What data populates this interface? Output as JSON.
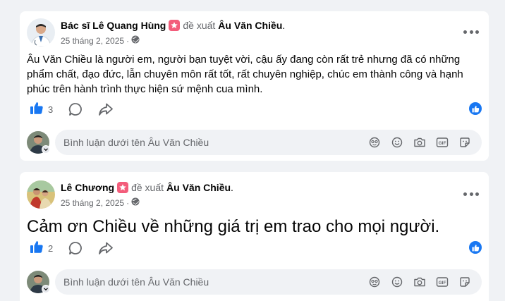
{
  "posts": [
    {
      "author": "Bác sĩ Lê Quang Hùng",
      "recommend_text": "đề xuất",
      "target": "Âu Văn Chiều",
      "date": "25 tháng 2, 2025",
      "body": "Âu Văn Chiều là người em, người bạn tuyệt vời, cậu ấy đang còn rất trẻ nhưng đã có những phẩm chất, đạo đức, lẫn chuyên môn rất tốt, rất chuyên nghiệp, chúc em thành công và hạnh phúc trên hành trình thực hiện sứ mệnh cua mình.",
      "like_count": "3",
      "comment_placeholder": "Bình luận dưới tên Âu Văn Chiều"
    },
    {
      "author": "Lê Chương",
      "recommend_text": "đề xuất",
      "target": "Âu Văn Chiều",
      "date": "25 tháng 2, 2025",
      "body": "Cảm ơn Chiều về những giá trị em trao cho mọi người.",
      "like_count": "2",
      "comment_placeholder": "Bình luận dưới tên Âu Văn Chiều"
    }
  ],
  "colors": {
    "background": "#f0f2f5",
    "card": "#ffffff",
    "accent_blue": "#1877f2",
    "muted_text": "#65676b",
    "badge_pink": "#f35d7b"
  },
  "icons": {
    "like": "thumbs-up-icon",
    "comment": "speech-bubble-icon",
    "share": "share-arrow-icon",
    "privacy": "globe-icon",
    "more": "more-dots-icon",
    "reaction": "like-reaction-icon",
    "avatar_dropdown": "chevron-down-icon",
    "comment_tools": [
      "avatar-sticker-icon",
      "emoji-icon",
      "camera-icon",
      "gif-icon",
      "sticker-icon"
    ]
  }
}
